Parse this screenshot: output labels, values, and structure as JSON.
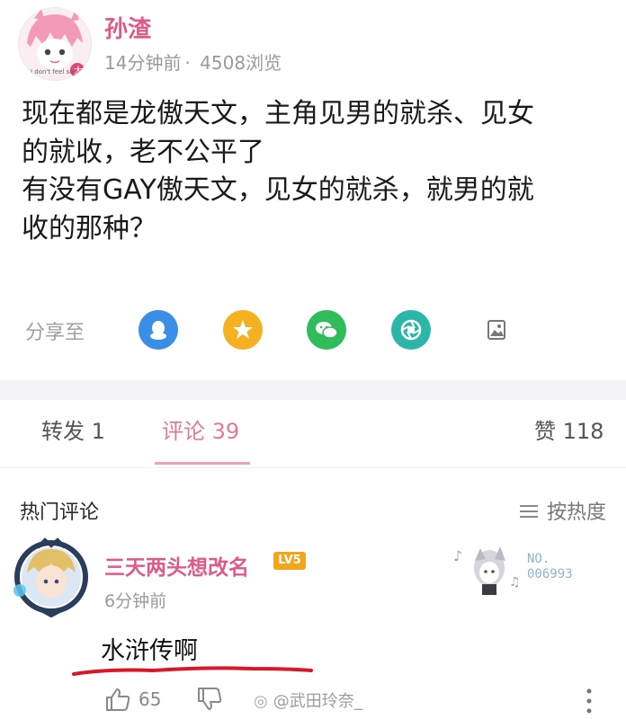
{
  "post": {
    "author": "孙渣",
    "time": "14分钟前",
    "separator": "·",
    "views": "4508浏览",
    "avatar_caption": "I don't feel so...",
    "text": "现在都是龙傲天文，主角见男的就杀、见女\n的就收，老不公平了\n有没有GAY傲天文，见女的就杀，就男的就\n收的那种？"
  },
  "share": {
    "label": "分享至",
    "icons": [
      "qq-icon",
      "qzone-star-icon",
      "wechat-icon",
      "moments-icon",
      "gallery-icon"
    ]
  },
  "tabs": {
    "repost": "转发 1",
    "comments": "评论 39",
    "likes": "赞 118"
  },
  "hot": {
    "title": "热门评论",
    "sort_label": "按热度"
  },
  "comment": {
    "user": "三天两头想改名",
    "level_badge": "LV5",
    "time": "6分钟前",
    "no_line1": "NO.",
    "no_line2": "006993",
    "text": "水浒传啊",
    "likes": "65",
    "watermark": "@武田玲奈_"
  },
  "colors": {
    "name_pink": "#e05a88",
    "tab_active": "#e07a99",
    "qq_blue": "#3a8ee6",
    "qzone_yellow": "#f5b11f",
    "wechat_green": "#2ebd58",
    "moments_teal": "#2ab7a9",
    "underline_red": "#d8182a"
  }
}
